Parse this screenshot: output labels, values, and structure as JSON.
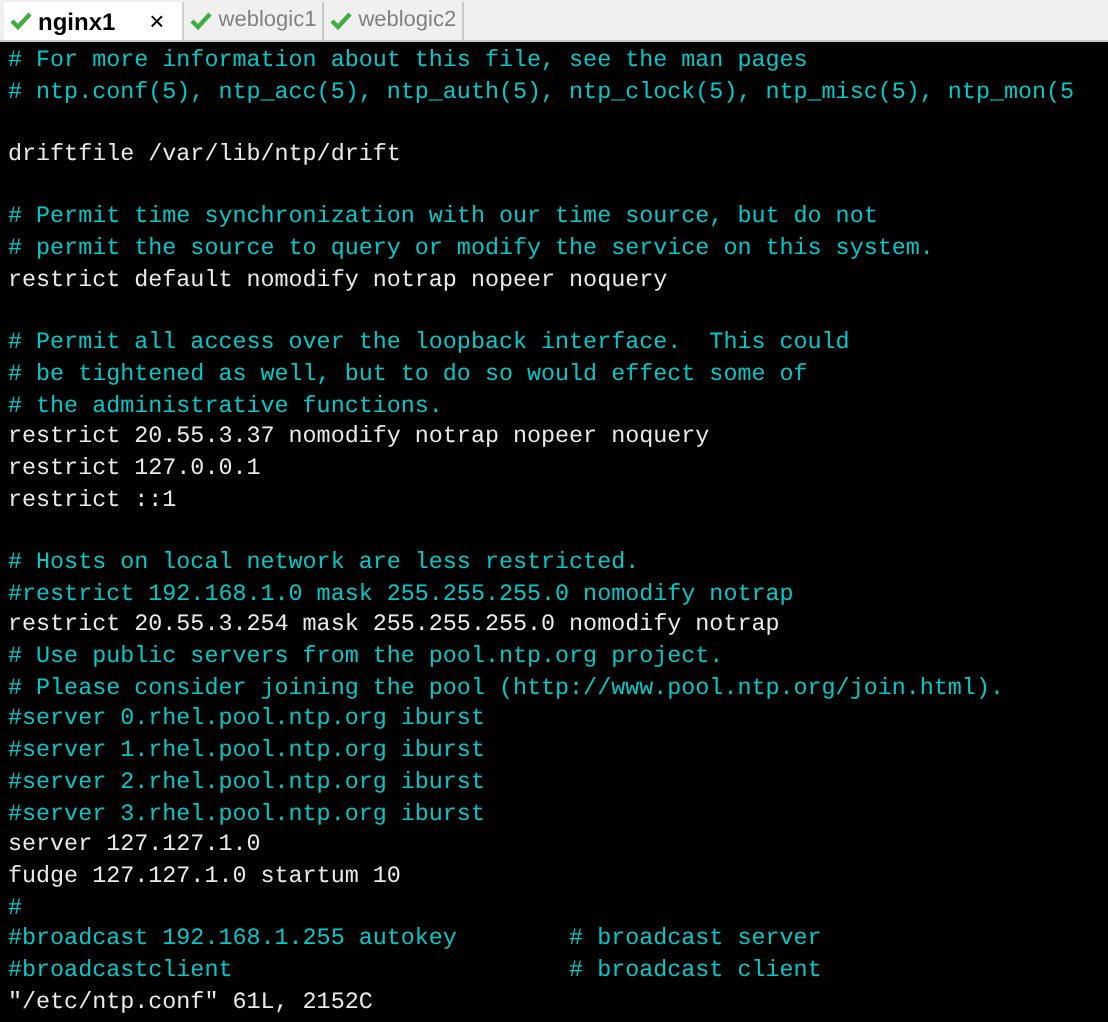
{
  "tabs": [
    {
      "label": "nginx1",
      "selected": true,
      "close": "×"
    },
    {
      "label": "weblogic1",
      "selected": false
    },
    {
      "label": "weblogic2",
      "selected": false
    }
  ],
  "terminal": {
    "lines": [
      {
        "kind": "comment",
        "text": "# For more information about this file, see the man pages"
      },
      {
        "kind": "comment",
        "text": "# ntp.conf(5), ntp_acc(5), ntp_auth(5), ntp_clock(5), ntp_misc(5), ntp_mon(5"
      },
      {
        "kind": "blank"
      },
      {
        "kind": "plain",
        "text": "driftfile /var/lib/ntp/drift"
      },
      {
        "kind": "blank"
      },
      {
        "kind": "comment",
        "text": "# Permit time synchronization with our time source, but do not"
      },
      {
        "kind": "comment",
        "text": "# permit the source to query or modify the service on this system."
      },
      {
        "kind": "plain",
        "text": "restrict default nomodify notrap nopeer noquery"
      },
      {
        "kind": "blank"
      },
      {
        "kind": "comment",
        "text": "# Permit all access over the loopback interface.  This could"
      },
      {
        "kind": "comment",
        "text": "# be tightened as well, but to do so would effect some of"
      },
      {
        "kind": "comment",
        "text": "# the administrative functions."
      },
      {
        "kind": "plain",
        "text": "restrict 20.55.3.37 nomodify notrap nopeer noquery"
      },
      {
        "kind": "plain",
        "text": "restrict 127.0.0.1"
      },
      {
        "kind": "plain",
        "text": "restrict ::1"
      },
      {
        "kind": "blank"
      },
      {
        "kind": "comment",
        "text": "# Hosts on local network are less restricted."
      },
      {
        "kind": "comment",
        "text": "#restrict 192.168.1.0 mask 255.255.255.0 nomodify notrap"
      },
      {
        "kind": "plain",
        "text": "restrict 20.55.3.254 mask 255.255.255.0 nomodify notrap"
      },
      {
        "kind": "comment",
        "text": "# Use public servers from the pool.ntp.org project."
      },
      {
        "kind": "comment",
        "text": "# Please consider joining the pool (http://www.pool.ntp.org/join.html)."
      },
      {
        "kind": "comment",
        "text": "#server 0.rhel.pool.ntp.org iburst"
      },
      {
        "kind": "comment",
        "text": "#server 1.rhel.pool.ntp.org iburst"
      },
      {
        "kind": "comment",
        "text": "#server 2.rhel.pool.ntp.org iburst"
      },
      {
        "kind": "comment",
        "text": "#server 3.rhel.pool.ntp.org iburst"
      },
      {
        "kind": "plain",
        "text": "server 127.127.1.0"
      },
      {
        "kind": "plain",
        "text": "fudge 127.127.1.0 startum 10"
      },
      {
        "kind": "comment",
        "text": "#"
      },
      {
        "kind": "comment",
        "text": "#broadcast 192.168.1.255 autokey        # broadcast server"
      },
      {
        "kind": "comment",
        "text": "#broadcastclient                        # broadcast client"
      },
      {
        "kind": "plain",
        "text": "\"/etc/ntp.conf\" 61L, 2152C"
      }
    ]
  }
}
